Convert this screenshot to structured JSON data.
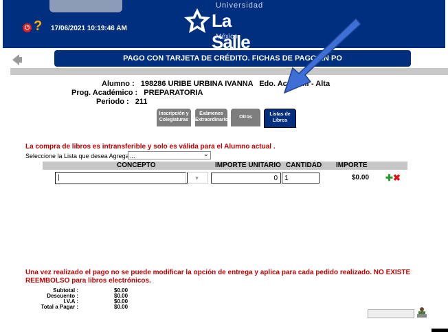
{
  "header": {
    "datetime": "17/06/2021 10:19:46 AM",
    "logo_top": "Universidad",
    "logo_main": "La Salle",
    "logo_bottom": "México",
    "power_icon": "power-icon",
    "help_icon": "help-icon"
  },
  "page": {
    "title": "PAGO CON TARJETA DE CRÉDITO. FICHAS DE PAGO EN P",
    "title_tail": "O",
    "back_icon": "back-arrow-icon"
  },
  "student": {
    "alumno_label": "Alumno :",
    "alumno_value": "198286 URIBE URBINA IVANNA",
    "edo_label": "Edo. Académi",
    "edo_value": "- Alta",
    "prog_label": "Prog. Académico :",
    "prog_value": "PREPARATORIA",
    "periodo_label": "Periodo :",
    "periodo_value": "211"
  },
  "tabs": [
    {
      "label": "Inscripción y Colegiaturas",
      "active": false
    },
    {
      "label": "Exámenes Extraordinarios",
      "active": false
    },
    {
      "label": "Otros",
      "active": false
    },
    {
      "label": "Listas de Libros",
      "active": true
    }
  ],
  "notices": {
    "top": "La compra de libros es intransferible y solo es válida para el Alumno actual .",
    "bottom": "Una vez realizado el pago no se puede modificar la opción de entrega y aplica para cada pedido realizado. NO EXISTE REEMBOLSO para libros electrónicos."
  },
  "list_select": {
    "label": "Seleccione la Lista que desea Agregar:",
    "value": "..."
  },
  "table": {
    "headers": [
      "CONCEPTO",
      "IMPORTE UNITARIO",
      "CANTIDAD",
      "IMPORTE"
    ],
    "row": {
      "concepto": "|",
      "importe_unitario": "0",
      "cantidad": "1",
      "importe": "$0.00"
    }
  },
  "totals": [
    {
      "label": "Subtotal :",
      "value": "$0.00"
    },
    {
      "label": "Descuento :",
      "value": "$0.00"
    },
    {
      "label": "I.V.A :",
      "value": "$0.00"
    },
    {
      "label": "Total a Pagar :",
      "value": "$0.00"
    }
  ],
  "colors": {
    "brand_blue": "#002f80",
    "warning_red": "#c00000",
    "annotation_arrow": "#3d6fd6"
  }
}
